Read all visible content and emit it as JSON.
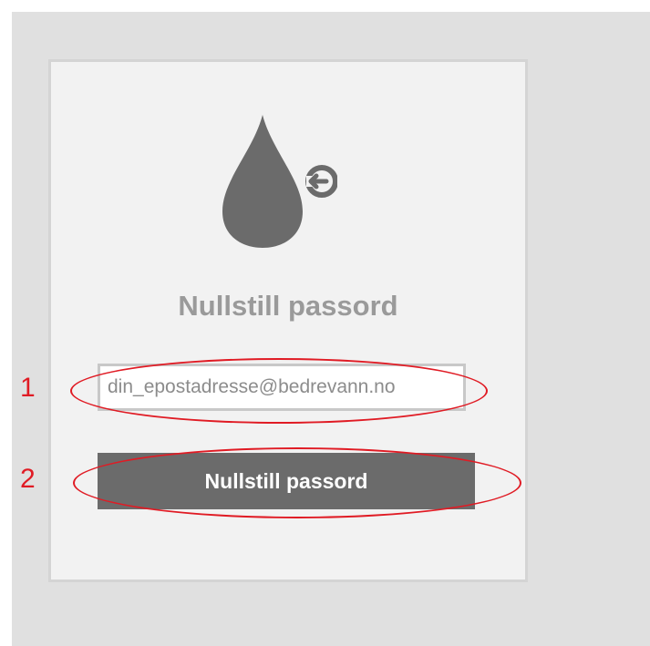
{
  "reset_form": {
    "title": "Nullstill passord",
    "email_placeholder": "din_epostadresse@bedrevann.no",
    "email_value": "",
    "submit_label": "Nullstill passord"
  },
  "annotations": [
    {
      "number": "1",
      "target": "email-input"
    },
    {
      "number": "2",
      "target": "submit-button"
    }
  ],
  "colors": {
    "annotation": "#e01b24",
    "button": "#6b6b6b",
    "logo": "#6b6b6b",
    "title": "#9a9a9a",
    "card": "#f2f2f2",
    "backdrop": "#e0e0e0"
  },
  "icons": {
    "logo": "water-drop-logout-icon"
  }
}
